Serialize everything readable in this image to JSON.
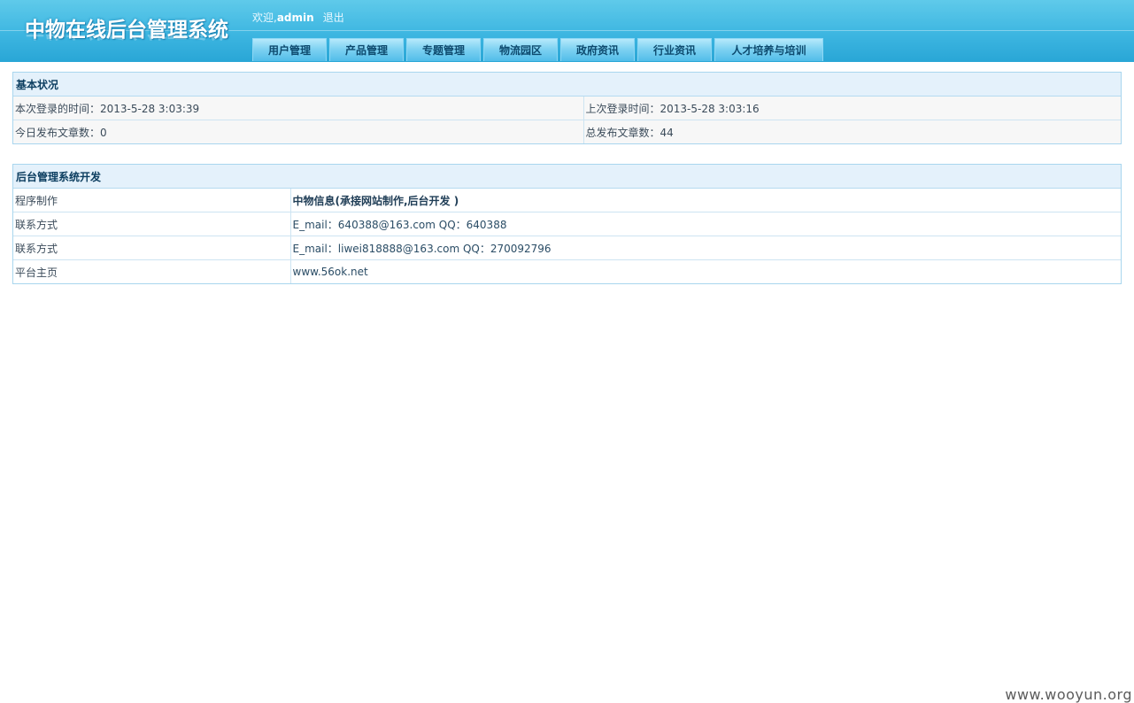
{
  "header": {
    "logo_text": "中物在线后台管理系统",
    "welcome_prefix": "欢迎,",
    "username": "admin",
    "logout": "退出",
    "nav": [
      "用户管理",
      "产品管理",
      "专题管理",
      "物流园区",
      "政府资讯",
      "行业资讯",
      "人才培养与培训"
    ]
  },
  "status": {
    "title": "基本状况",
    "current_login": "本次登录的时间：2013-5-28 3:03:39",
    "last_login": "上次登录时间：2013-5-28 3:03:16",
    "today_posts": "今日发布文章数：0",
    "total_posts": "总发布文章数：44"
  },
  "dev": {
    "title": "后台管理系统开发",
    "rows": [
      {
        "label": "程序制作",
        "value": "中物信息(承接网站制作,后台开发 )"
      },
      {
        "label": "联系方式",
        "value": "E_mail：640388@163.com  QQ：640388"
      },
      {
        "label": "联系方式",
        "value": "E_mail：liwei818888@163.com  QQ：270092796"
      },
      {
        "label": "平台主页",
        "value": "www.56ok.net"
      }
    ]
  },
  "watermark": "www.wooyun.org"
}
